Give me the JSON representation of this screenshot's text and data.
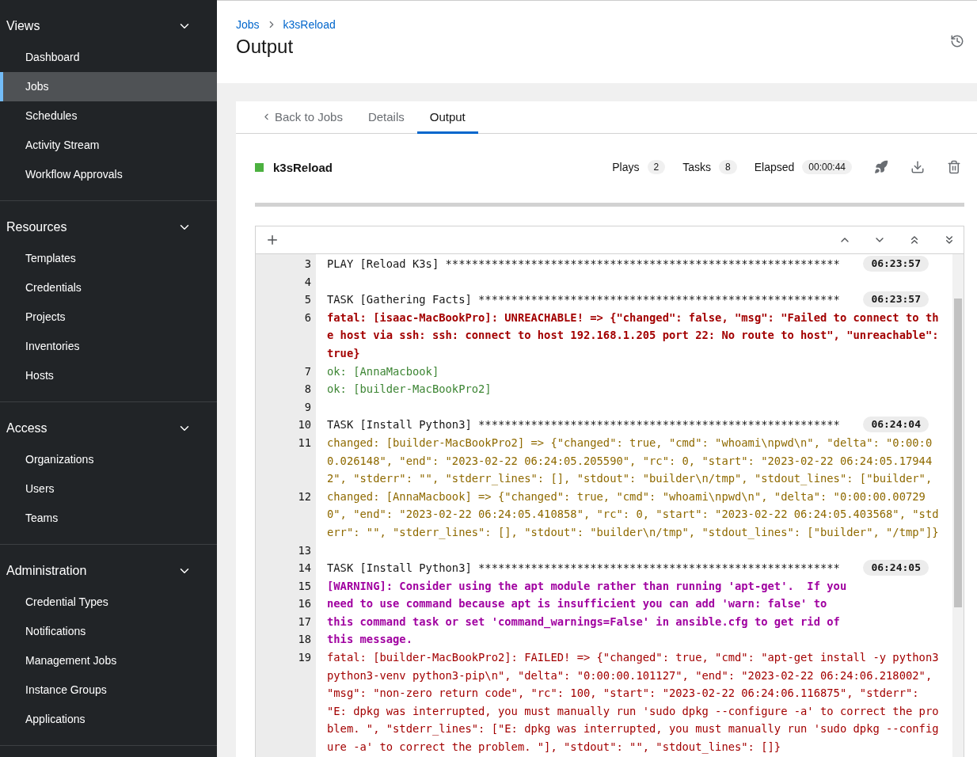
{
  "sidebar": {
    "groups": [
      {
        "title": "Views",
        "expanded": true,
        "items": [
          {
            "label": "Dashboard",
            "selected": false
          },
          {
            "label": "Jobs",
            "selected": true
          },
          {
            "label": "Schedules",
            "selected": false
          },
          {
            "label": "Activity Stream",
            "selected": false
          },
          {
            "label": "Workflow Approvals",
            "selected": false
          }
        ]
      },
      {
        "title": "Resources",
        "expanded": true,
        "items": [
          {
            "label": "Templates",
            "selected": false
          },
          {
            "label": "Credentials",
            "selected": false
          },
          {
            "label": "Projects",
            "selected": false
          },
          {
            "label": "Inventories",
            "selected": false
          },
          {
            "label": "Hosts",
            "selected": false
          }
        ]
      },
      {
        "title": "Access",
        "expanded": true,
        "items": [
          {
            "label": "Organizations",
            "selected": false
          },
          {
            "label": "Users",
            "selected": false
          },
          {
            "label": "Teams",
            "selected": false
          }
        ]
      },
      {
        "title": "Administration",
        "expanded": true,
        "items": [
          {
            "label": "Credential Types",
            "selected": false
          },
          {
            "label": "Notifications",
            "selected": false
          },
          {
            "label": "Management Jobs",
            "selected": false
          },
          {
            "label": "Instance Groups",
            "selected": false
          },
          {
            "label": "Applications",
            "selected": false
          }
        ]
      }
    ]
  },
  "breadcrumb": [
    "Jobs",
    "k3sReload"
  ],
  "page_title": "Output",
  "tabs": [
    {
      "label": "Back to Jobs",
      "kind": "back",
      "selected": false
    },
    {
      "label": "Details",
      "kind": "tab",
      "selected": false
    },
    {
      "label": "Output",
      "kind": "tab",
      "selected": true
    }
  ],
  "job": {
    "name": "k3sReload",
    "color": "#4cb140",
    "stats": [
      {
        "label": "Plays",
        "value": "2"
      },
      {
        "label": "Tasks",
        "value": "8"
      },
      {
        "label": "Elapsed",
        "value": "00:00:44"
      }
    ]
  },
  "log": [
    {
      "number": "3",
      "kind": "header",
      "segments": [
        "PLAY [Reload K3s] ************************************************************"
      ],
      "time": "06:23:57"
    },
    {
      "number": "4",
      "kind": "blank"
    },
    {
      "number": "5",
      "kind": "header",
      "segments": [
        "TASK [Gathering Facts] *******************************************************"
      ],
      "time": "06:23:57"
    },
    {
      "number": "6",
      "kind": "unreachable",
      "segments": [
        "fatal: [isaac-MacBookPro]: UNREACHABLE! => {\"changed\": false, \"msg\": \"Failed to connect to th",
        "e host via ssh: ssh: connect to host 192.168.1.205 port 22: No route to host\", \"unreachable\":",
        "true}"
      ]
    },
    {
      "number": "7",
      "kind": "ok",
      "segments": [
        "ok: [AnnaMacbook]"
      ]
    },
    {
      "number": "8",
      "kind": "ok",
      "segments": [
        "ok: [builder-MacBookPro2]"
      ]
    },
    {
      "number": "9",
      "kind": "blank"
    },
    {
      "number": "10",
      "kind": "header",
      "segments": [
        "TASK [Install Python3] *******************************************************"
      ],
      "time": "06:24:04"
    },
    {
      "number": "11",
      "kind": "changed",
      "segments": [
        "changed: [builder-MacBookPro2] => {\"changed\": true, \"cmd\": \"whoami\\npwd\\n\", \"delta\": \"0:00:0",
        "0.026148\", \"end\": \"2023-02-22 06:24:05.205590\", \"rc\": 0, \"start\": \"2023-02-22 06:24:05.17944",
        "2\", \"stderr\": \"\", \"stderr_lines\": [], \"stdout\": \"builder\\n/tmp\", \"stdout_lines\": [\"builder\","
      ]
    },
    {
      "number": "12",
      "kind": "changed",
      "segments": [
        "changed: [AnnaMacbook] => {\"changed\": true, \"cmd\": \"whoami\\npwd\\n\", \"delta\": \"0:00:00.00729",
        "0\", \"end\": \"2023-02-22 06:24:05.410858\", \"rc\": 0, \"start\": \"2023-02-22 06:24:05.403568\", \"std",
        "err\": \"\", \"stderr_lines\": [], \"stdout\": \"builder\\n/tmp\", \"stdout_lines\": [\"builder\", \"/tmp\"]}"
      ]
    },
    {
      "number": "13",
      "kind": "blank"
    },
    {
      "number": "14",
      "kind": "header",
      "segments": [
        "TASK [Install Python3] *******************************************************"
      ],
      "time": "06:24:05"
    },
    {
      "number": "15",
      "kind": "warning",
      "segments": [
        "[WARNING]: Consider using the apt module rather than running 'apt-get'.  If you"
      ]
    },
    {
      "number": "16",
      "kind": "warning",
      "segments": [
        "need to use command because apt is insufficient you can add 'warn: false' to"
      ]
    },
    {
      "number": "17",
      "kind": "warning",
      "segments": [
        "this command task or set 'command_warnings=False' in ansible.cfg to get rid of"
      ]
    },
    {
      "number": "18",
      "kind": "warning",
      "segments": [
        "this message."
      ]
    },
    {
      "number": "19",
      "kind": "failed",
      "segments": [
        "fatal: [builder-MacBookPro2]: FAILED! => {\"changed\": true, \"cmd\": \"apt-get install -y python3",
        "python3-venv python3-pip\\n\", \"delta\": \"0:00:00.101127\", \"end\": \"2023-02-22 06:24:06.218002\",",
        "\"msg\": \"non-zero return code\", \"rc\": 100, \"start\": \"2023-02-22 06:24:06.116875\", \"stderr\":",
        "\"E: dpkg was interrupted, you must manually run 'sudo dpkg --configure -a' to correct the pro",
        "blem. \", \"stderr_lines\": [\"E: dpkg was interrupted, you must manually run 'sudo dpkg --config",
        "ure -a' to correct the problem. \"], \"stdout\": \"\", \"stdout_lines\": []}"
      ]
    }
  ]
}
